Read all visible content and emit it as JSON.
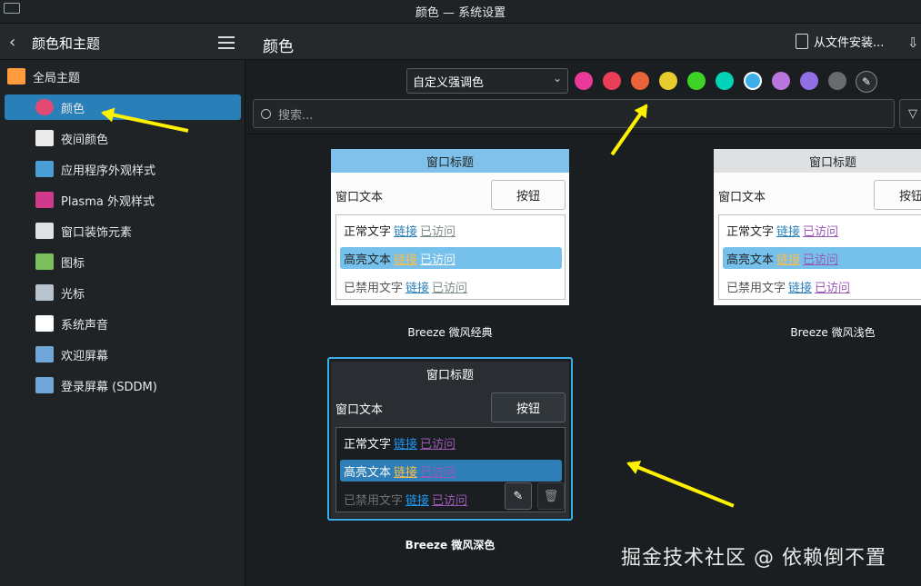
{
  "window": {
    "title": "颜色 — 系统设置"
  },
  "header": {
    "sidebar_title": "颜色和主题",
    "page_title": "颜色",
    "install_label": "从文件安装..."
  },
  "sidebar": {
    "items": [
      {
        "label": "全局主题",
        "icon": "global-theme-icon",
        "color": "#ff9b3d"
      },
      {
        "label": "颜色",
        "icon": "color-wheel-icon",
        "color": "#e24a75",
        "active": true
      },
      {
        "label": "夜间颜色",
        "icon": "night-color-icon",
        "color": "#eaeaea"
      },
      {
        "label": "应用程序外观样式",
        "icon": "app-style-icon",
        "color": "#4a9ed6"
      },
      {
        "label": "Plasma 外观样式",
        "icon": "plasma-style-icon",
        "color": "#d13a8a"
      },
      {
        "label": "窗口装饰元素",
        "icon": "window-decoration-icon",
        "color": "#dde2e6"
      },
      {
        "label": "图标",
        "icon": "icons-icon",
        "color": "#7bbf5b"
      },
      {
        "label": "光标",
        "icon": "cursor-icon",
        "color": "#b7c3cd"
      },
      {
        "label": "系统声音",
        "icon": "sound-icon",
        "color": "#ffffff"
      },
      {
        "label": "欢迎屏幕",
        "icon": "splash-icon",
        "color": "#6fa8d8"
      },
      {
        "label": "登录屏幕 (SDDM)",
        "icon": "login-screen-icon",
        "color": "#6fa8d8"
      }
    ]
  },
  "toolbar": {
    "accent_select": "自定义强调色",
    "swatches": [
      "#e93a9a",
      "#e93d58",
      "#e9643a",
      "#e8cb2d",
      "#3dd425",
      "#00d3b8",
      "#3daee9",
      "#b875dc",
      "#926ee4",
      "#686b6f"
    ],
    "selected_swatch": 6,
    "search_placeholder": "搜索..."
  },
  "schemes": [
    {
      "name": "Breeze 微风经典",
      "variant": "classic",
      "titlebar_color": "#7fc1ea",
      "window_title": "窗口标题",
      "window_text": "窗口文本",
      "button": "按钮",
      "normal": "正常文字",
      "link": "链接",
      "visited": "已访问",
      "highlight": "高亮文本",
      "disabled": "已禁用文字",
      "link_color": "#2980b9",
      "visited_color": "#7f8c8d",
      "highlight_bg": "#76c0ec",
      "highlight_link": "#fdbc4b",
      "highlight_visited": "#f4f7f8"
    },
    {
      "name": "Breeze 微风浅色",
      "variant": "light",
      "titlebar_color": "#dee0e2",
      "window_title": "窗口标题",
      "window_text": "窗口文本",
      "button": "按钮",
      "normal": "正常文字",
      "link": "链接",
      "visited": "已访问",
      "highlight": "高亮文本",
      "disabled": "已禁用文字",
      "link_color": "#2980b9",
      "visited_color": "#9b59b6",
      "highlight_bg": "#76c0ec",
      "highlight_link": "#fdbc4b",
      "highlight_visited": "#9b59b6"
    },
    {
      "name": "Breeze 微风深色",
      "variant": "dark",
      "titlebar_color": "#2a2e32",
      "window_title": "窗口标题",
      "window_text": "窗口文本",
      "button": "按钮",
      "normal": "正常文字",
      "link": "链接",
      "visited": "已访问",
      "highlight": "高亮文本",
      "disabled": "已禁用文字",
      "link_color": "#1d99f3",
      "visited_color": "#9b59b6",
      "highlight_bg": "#2e7fb7",
      "highlight_link": "#fdbc4b",
      "highlight_visited": "#9b59b6"
    }
  ],
  "watermark": "掘金技术社区 @ 依赖倒不置"
}
